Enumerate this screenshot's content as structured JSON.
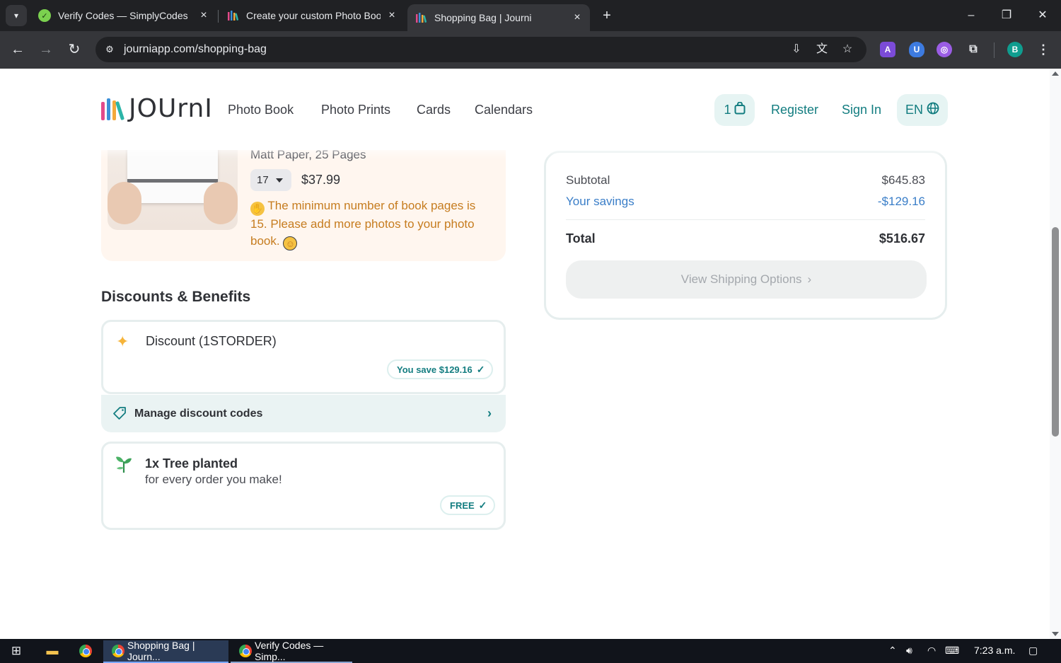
{
  "browser": {
    "tabs": [
      {
        "title": "Verify Codes — SimplyCodes",
        "icon": "simplycodes-icon"
      },
      {
        "title": "Create your custom Photo Book",
        "icon": "journi-icon"
      },
      {
        "title": "Shopping Bag | Journi",
        "icon": "journi-icon"
      }
    ],
    "url": "journiapp.com/shopping-bag"
  },
  "site": {
    "logo_text": "JOUrnI",
    "nav": [
      "Photo Book",
      "Photo Prints",
      "Cards",
      "Calendars"
    ],
    "cart_count": "1",
    "register": "Register",
    "sign_in": "Sign In",
    "language": "EN"
  },
  "product": {
    "paper": "Matt Paper, 25 Pages",
    "quantity": "17",
    "price": "$37.99",
    "warning": "The minimum number of book pages is 15. Please add more photos to your photo book."
  },
  "discounts": {
    "title": "Discounts & Benefits",
    "discount_name": "Discount (1STORDER)",
    "savings_badge": "You save $129.16",
    "manage_label": "Manage discount codes",
    "tree_title": "1x Tree planted",
    "tree_sub": "for every order you make!",
    "free_badge": "FREE"
  },
  "summary": {
    "subtotal_label": "Subtotal",
    "subtotal_value": "$645.83",
    "savings_label": "Your savings",
    "savings_value": "-$129.16",
    "total_label": "Total",
    "total_value": "$516.67",
    "shipping_button": "View Shipping Options"
  },
  "taskbar": {
    "apps": [
      "Shopping Bag | Journ...",
      "Verify Codes — Simp..."
    ],
    "time": "7:23 a.m."
  },
  "colors": {
    "accent": "#137d80",
    "warning": "#c67c1f",
    "savings": "#3a7ec8"
  }
}
